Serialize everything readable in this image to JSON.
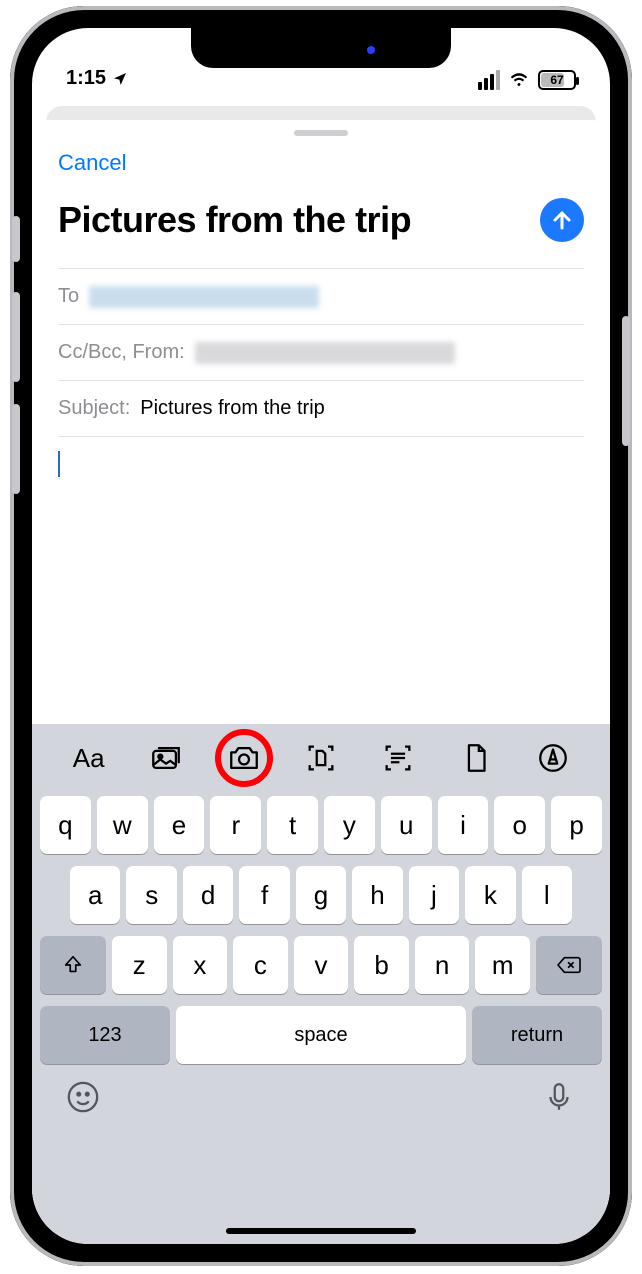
{
  "status": {
    "time": "1:15",
    "battery": "67"
  },
  "sheet": {
    "cancel": "Cancel",
    "title": "Pictures from the trip",
    "to_label": "To",
    "cc_label": "Cc/Bcc, From:",
    "subject_label": "Subject:",
    "subject_value": "Pictures from the trip"
  },
  "toolbar": {
    "text_format": "Aa"
  },
  "keyboard": {
    "row1": [
      "q",
      "w",
      "e",
      "r",
      "t",
      "y",
      "u",
      "i",
      "o",
      "p"
    ],
    "row2": [
      "a",
      "s",
      "d",
      "f",
      "g",
      "h",
      "j",
      "k",
      "l"
    ],
    "row3": [
      "z",
      "x",
      "c",
      "v",
      "b",
      "n",
      "m"
    ],
    "numbers": "123",
    "space": "space",
    "return": "return"
  }
}
